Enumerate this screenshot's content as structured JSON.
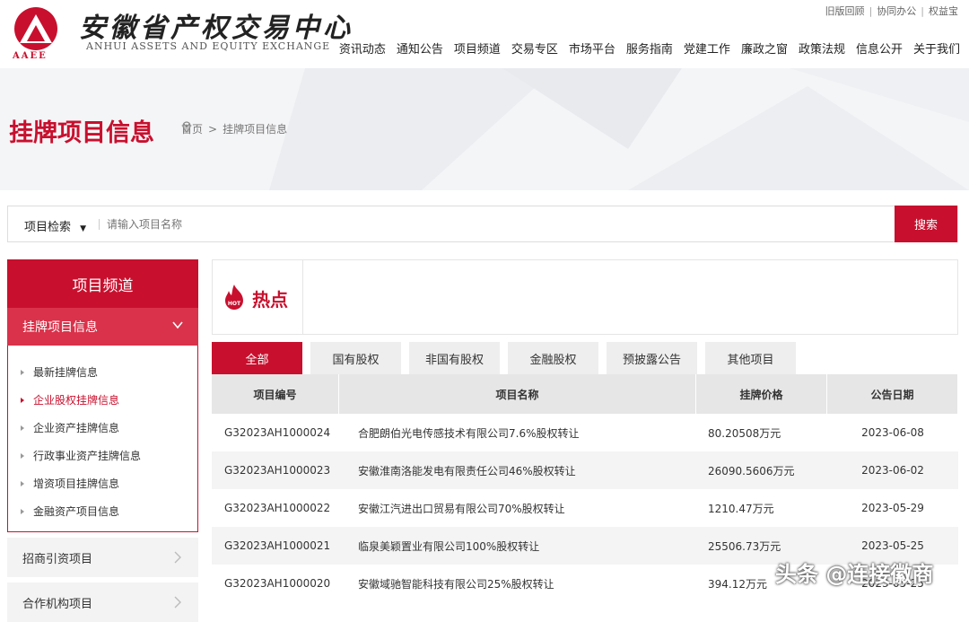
{
  "header": {
    "logo_cn": "安徽省产权交易中心",
    "logo_en": "ANHUI ASSETS AND EQUITY EXCHANGE",
    "logo_abbr": "AAEE",
    "top_links": [
      "旧版回顾",
      "协同办公",
      "权益宝"
    ],
    "nav": [
      "资讯动态",
      "通知公告",
      "项目频道",
      "交易专区",
      "市场平台",
      "服务指南",
      "党建工作",
      "廉政之窗",
      "政策法规",
      "信息公开",
      "关于我们"
    ]
  },
  "banner": {
    "title": "挂牌项目信息",
    "breadcrumb_home": "首页",
    "breadcrumb_sep": ">",
    "breadcrumb_current": "挂牌项目信息"
  },
  "search": {
    "category": "项目检索",
    "placeholder": "请输入项目名称",
    "button": "搜索"
  },
  "sidebar": {
    "title": "项目频道",
    "active_section": "挂牌项目信息",
    "items": [
      {
        "label": "最新挂牌信息",
        "active": false
      },
      {
        "label": "企业股权挂牌信息",
        "active": true
      },
      {
        "label": "企业资产挂牌信息",
        "active": false
      },
      {
        "label": "行政事业资产挂牌信息",
        "active": false
      },
      {
        "label": "增资项目挂牌信息",
        "active": false
      },
      {
        "label": "金融资产项目信息",
        "active": false
      }
    ],
    "more": [
      "招商引资项目",
      "合作机构项目"
    ]
  },
  "hot": {
    "icon_text": "HOT",
    "title": "热点"
  },
  "tabs": [
    {
      "label": "全部",
      "active": true
    },
    {
      "label": "国有股权",
      "active": false
    },
    {
      "label": "非国有股权",
      "active": false
    },
    {
      "label": "金融股权",
      "active": false
    },
    {
      "label": "预披露公告",
      "active": false
    },
    {
      "label": "其他项目",
      "active": false
    }
  ],
  "table": {
    "headers": [
      "项目编号",
      "项目名称",
      "挂牌价格",
      "公告日期"
    ],
    "rows": [
      [
        "G32023AH1000024",
        "合肥朗伯光电传感技术有限公司7.6%股权转让",
        "80.20508万元",
        "2023-06-08"
      ],
      [
        "G32023AH1000023",
        "安徽淮南洛能发电有限责任公司46%股权转让",
        "26090.5606万元",
        "2023-06-02"
      ],
      [
        "G32023AH1000022",
        "安徽江汽进出口贸易有限公司70%股权转让",
        "1210.47万元",
        "2023-05-29"
      ],
      [
        "G32023AH1000021",
        "临泉美颖置业有限公司100%股权转让",
        "25506.73万元",
        "2023-05-25"
      ],
      [
        "G32023AH1000020",
        "安徽域驰智能科技有限公司25%股权转让",
        "394.12万元",
        "2023-05-25"
      ]
    ]
  },
  "watermark": "头条 @连接徽商",
  "colors": {
    "brand": "#c8102e"
  }
}
